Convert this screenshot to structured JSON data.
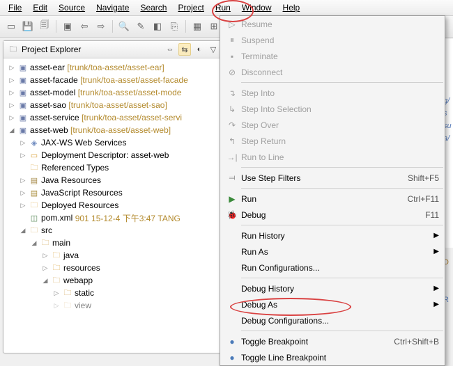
{
  "menubar": {
    "file": "File",
    "edit": "Edit",
    "source": "Source",
    "navigate": "Navigate",
    "search": "Search",
    "project": "Project",
    "run": "Run",
    "window": "Window",
    "help": "Help"
  },
  "panel": {
    "title": "Project Explorer"
  },
  "tree": {
    "p1": {
      "name": "asset-ear",
      "path": "[trunk/toa-asset/asset-ear]"
    },
    "p2": {
      "name": "asset-facade",
      "path": "[trunk/toa-asset/asset-facade"
    },
    "p3": {
      "name": "asset-model",
      "path": "[trunk/toa-asset/asset-mode"
    },
    "p4": {
      "name": "asset-sao",
      "path": "[trunk/toa-asset/asset-sao]"
    },
    "p5": {
      "name": "asset-service",
      "path": "[trunk/toa-asset/asset-servi"
    },
    "p6": {
      "name": "asset-web",
      "path": "[trunk/toa-asset/asset-web]"
    },
    "jax": "JAX-WS Web Services",
    "dd": "Deployment Descriptor: asset-web",
    "ref": "Referenced Types",
    "jres": "Java Resources",
    "jsres": "JavaScript Resources",
    "dep": "Deployed Resources",
    "pom": {
      "name": "pom.xml",
      "info": "901  15-12-4  下午3:47  TANG"
    },
    "src": "src",
    "main": "main",
    "java": "java",
    "resources": "resources",
    "webapp": "webapp",
    "static": "static",
    "view": "view"
  },
  "menu": {
    "resume": "Resume",
    "suspend": "Suspend",
    "terminate": "Terminate",
    "disconnect": "Disconnect",
    "stepinto": "Step Into",
    "stepsel": "Step Into Selection",
    "stepover": "Step Over",
    "stepret": "Step Return",
    "runto": "Run to Line",
    "usefilters": "Use Step Filters",
    "sc_filters": "Shift+F5",
    "run": "Run",
    "sc_run": "Ctrl+F11",
    "debug": "Debug",
    "sc_debug": "F11",
    "runhist": "Run History",
    "runas": "Run As",
    "runconf": "Run Configurations...",
    "dbghist": "Debug History",
    "dbgas": "Debug As",
    "dbgconf": "Debug Configurations...",
    "togglebp": "Toggle Breakpoint",
    "sc_togglebp": "Ctrl+Shift+B",
    "toggleline": "Toggle Line Breakpoint"
  },
  "right": {
    "a": "g/",
    "b": "s",
    "c": "su",
    "d": "a/"
  }
}
